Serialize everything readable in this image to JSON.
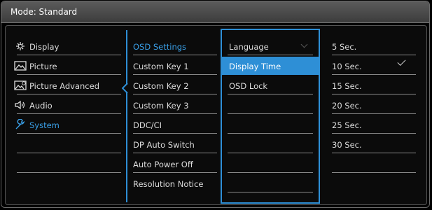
{
  "title": "Mode: Standard",
  "main_menu": [
    {
      "label": "Display",
      "icon": "sun-sparkle-icon"
    },
    {
      "label": "Picture",
      "icon": "mountain-picture-icon"
    },
    {
      "label": "Picture Advanced",
      "icon": "picture-advanced-icon"
    },
    {
      "label": "Audio",
      "icon": "speaker-icon"
    },
    {
      "label": "System",
      "icon": "wrench-icon",
      "active": true
    }
  ],
  "submenu": [
    {
      "label": "OSD Settings",
      "active": true
    },
    {
      "label": "Custom Key 1"
    },
    {
      "label": "Custom Key 2"
    },
    {
      "label": "Custom Key 3"
    },
    {
      "label": "DDC/CI"
    },
    {
      "label": "DP Auto Switch"
    },
    {
      "label": "Auto Power Off"
    },
    {
      "label": "Resolution Notice"
    }
  ],
  "osd_options": [
    {
      "label": "Language"
    },
    {
      "label": "Display Time",
      "selected": true
    },
    {
      "label": "OSD Lock"
    }
  ],
  "values": [
    {
      "label": "5 Sec."
    },
    {
      "label": "10 Sec."
    },
    {
      "label": "15 Sec.",
      "checked": true
    },
    {
      "label": "20 Sec."
    },
    {
      "label": "25 Sec."
    },
    {
      "label": "30 Sec."
    }
  ],
  "colors": {
    "accent": "#2e8fd6",
    "text": "#dcdcdc",
    "active_text": "#3aa0e8",
    "background": "#000000"
  }
}
